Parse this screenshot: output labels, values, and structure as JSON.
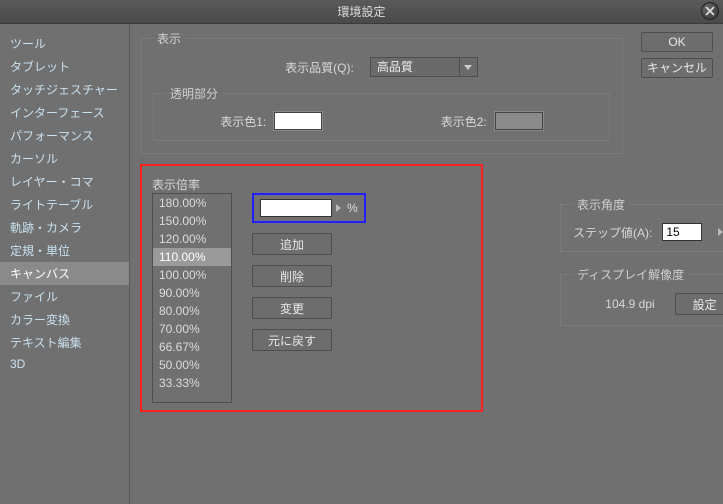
{
  "window": {
    "title": "環境設定"
  },
  "buttons": {
    "ok": "OK",
    "cancel": "キャンセル",
    "close_icon": "close"
  },
  "sidebar": {
    "items": [
      {
        "label": "ツール"
      },
      {
        "label": "タブレット"
      },
      {
        "label": "タッチジェスチャー"
      },
      {
        "label": "インターフェース"
      },
      {
        "label": "パフォーマンス"
      },
      {
        "label": "カーソル"
      },
      {
        "label": "レイヤー・コマ"
      },
      {
        "label": "ライトテーブル"
      },
      {
        "label": "軌跡・カメラ"
      },
      {
        "label": "定規・単位"
      },
      {
        "label": "キャンバス",
        "selected": true
      },
      {
        "label": "ファイル"
      },
      {
        "label": "カラー変換"
      },
      {
        "label": "テキスト編集"
      },
      {
        "label": "3D"
      }
    ]
  },
  "display": {
    "legend": "表示",
    "quality_label": "表示品質(Q):",
    "quality_value": "高品質",
    "transparency": {
      "legend": "透明部分",
      "color1_label": "表示色1:",
      "color2_label": "表示色2:",
      "color1": "#ffffff",
      "color2": "#8a8a8a"
    }
  },
  "zoom": {
    "legend": "表示倍率",
    "levels": [
      "180.00%",
      "150.00%",
      "120.00%",
      "110.00%",
      "100.00%",
      "90.00%",
      "80.00%",
      "70.00%",
      "66.67%",
      "50.00%",
      "33.33%"
    ],
    "selected_index": 3,
    "input_value": "",
    "unit": "%",
    "add": "追加",
    "delete": "削除",
    "change": "変更",
    "reset": "元に戻す"
  },
  "angle": {
    "legend": "表示角度",
    "step_label": "ステップ値(A):",
    "step_value": "15",
    "deg": "°"
  },
  "dpi": {
    "legend": "ディスプレイ解像度",
    "value": "104.9 dpi",
    "settings": "設定"
  }
}
